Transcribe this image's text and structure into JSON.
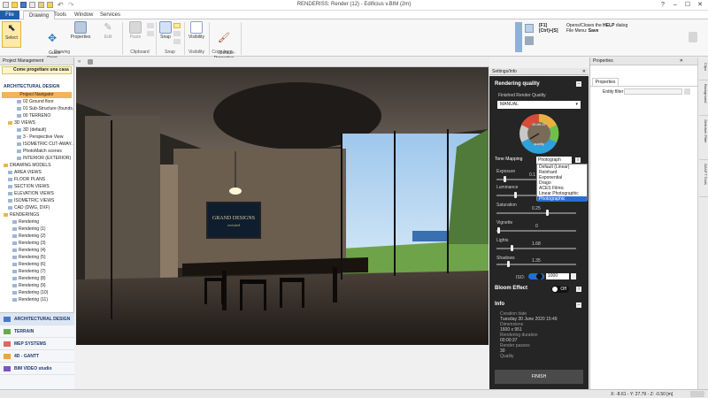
{
  "window": {
    "title": "RENDERISS: Render (12) - Edificius v.BIM (2m)",
    "controls": [
      "?",
      "–",
      "☐",
      "✕"
    ]
  },
  "menu": {
    "tabs": [
      "File",
      "Drawing",
      "Tools",
      "Window",
      "Services"
    ],
    "active": "Drawing"
  },
  "ribbon": {
    "select": "Select",
    "guide_point": "Guide\nPoint",
    "properties": "Properties",
    "edit": "Edit",
    "paste": "Paste",
    "snap": "Snap",
    "visibility": "Visibility",
    "default_properties": "Default\nProperties",
    "groups": [
      "Drawing",
      "Clipboard",
      "Snap",
      "Visibility",
      "Copy from..."
    ],
    "help_keys_1": "[F1]",
    "help_keys_2": "[Ctrl]+[S]",
    "help_text_1_prefix": "Opens/Closes the ",
    "help_text_1_bold": "HELP",
    "help_text_1_suffix": " dialog",
    "help_text_2_prefix": "File Menu: ",
    "help_text_2_bold": "Save"
  },
  "left_panel": {
    "header": "Project Management",
    "tip": "Come progettare una casa",
    "section": "ARCHITECTURAL DESIGN",
    "navigator": "Project Navigator",
    "tree": [
      {
        "label": "02 Ground floor",
        "indent": 3
      },
      {
        "label": "01 Sub-Structure (founds...",
        "indent": 3
      },
      {
        "label": "00 TERRENO",
        "indent": 3
      },
      {
        "label": "3D VIEWS",
        "indent": 1,
        "folder": true
      },
      {
        "label": "3D (default)",
        "indent": 3
      },
      {
        "label": "3 - Perspective View",
        "indent": 3
      },
      {
        "label": "ISOMETRIC CUT-AWAY...",
        "indent": 3
      },
      {
        "label": "PhotoMatch scenes",
        "indent": 3
      },
      {
        "label": "INTERIOR (EXTERIOR)",
        "indent": 3
      },
      {
        "label": "DRAWING MODELS",
        "indent": 0,
        "folder": true
      },
      {
        "label": "AREA VIEWS",
        "indent": 1
      },
      {
        "label": "FLOOR PLANS",
        "indent": 1
      },
      {
        "label": "SECTION VIEWS",
        "indent": 1
      },
      {
        "label": "ELEVATION VIEWS",
        "indent": 1
      },
      {
        "label": "ISOMETRIC VIEWS",
        "indent": 1
      },
      {
        "label": "CAD (DWG, DXF)",
        "indent": 1
      },
      {
        "label": "RENDERINGS",
        "indent": 0,
        "folder": true
      },
      {
        "label": "Rendering",
        "indent": 2
      },
      {
        "label": "Rendering (1)",
        "indent": 2
      },
      {
        "label": "Rendering (2)",
        "indent": 2
      },
      {
        "label": "Rendering (3)",
        "indent": 2
      },
      {
        "label": "Rendering (4)",
        "indent": 2
      },
      {
        "label": "Rendering (5)",
        "indent": 2
      },
      {
        "label": "Rendering (6)",
        "indent": 2
      },
      {
        "label": "Rendering (7)",
        "indent": 2
      },
      {
        "label": "Rendering (8)",
        "indent": 2
      },
      {
        "label": "Rendering (9)",
        "indent": 2
      },
      {
        "label": "Rendering (10)",
        "indent": 2
      },
      {
        "label": "Rendering (11)",
        "indent": 2
      },
      {
        "label": "Render (12)",
        "indent": 2,
        "selected": true
      }
    ],
    "nav": [
      "ARCHITECTURAL DESIGN",
      "TERRAIN",
      "MEP SYSTEMS",
      "4D - GANTT",
      "BIM VIDEO studio"
    ]
  },
  "viewport": {
    "poster_title": "GRAND DESIGNS",
    "poster_sub": "revisited"
  },
  "render": {
    "panel_title": "Settings/Info",
    "heading": "Rendering quality",
    "finished_label": "Finished Render Quality",
    "quality_value": "MANUAL",
    "gauge_time": "00:00:37",
    "gauge_label": "quality",
    "tone_label": "Tone Mapping",
    "tone_value": "Photograph",
    "tone_options": [
      "Default (Linear)",
      "Reinhard",
      "Exponential",
      "Drago",
      "ACES Filmic",
      "Linear Photographic",
      "Photographic"
    ],
    "exposure_label": "Exposure",
    "exposure_value": "0.1",
    "luminance_label": "Luminance",
    "saturation_label": "Saturation",
    "saturation_value": "0.25",
    "vignette_label": "Vignette",
    "vignette_value": "0",
    "lights_label": "Lights",
    "lights_value": "1.68",
    "shadows_label": "Shadows",
    "shadows_value": "1.35",
    "iso_label": "ISO:",
    "iso_value": "1000",
    "bloom_label": "Bloom Effect",
    "bloom_value": "Off",
    "info_label": "Info",
    "info": [
      {
        "k": "Creation date",
        "v": "Tuesday 30 June 2020 15:49"
      },
      {
        "k": "Dimensions",
        "v": "1600 x 951"
      },
      {
        "k": "Rendering duration",
        "v": "00:00:37"
      },
      {
        "k": "Render passes",
        "v": "30"
      },
      {
        "k": "Quality",
        "v": ""
      }
    ],
    "finish": "FINISH"
  },
  "properties": {
    "header": "Properties",
    "tab": "Properties",
    "filter_label": "Entity filter"
  },
  "right_tabs": [
    "Clips",
    "Background",
    "Selection Filter",
    "GANTT Tools"
  ],
  "status": {
    "coords": "X: -8.61 - Y: 27.79 - Z: -0.50 [m]"
  }
}
